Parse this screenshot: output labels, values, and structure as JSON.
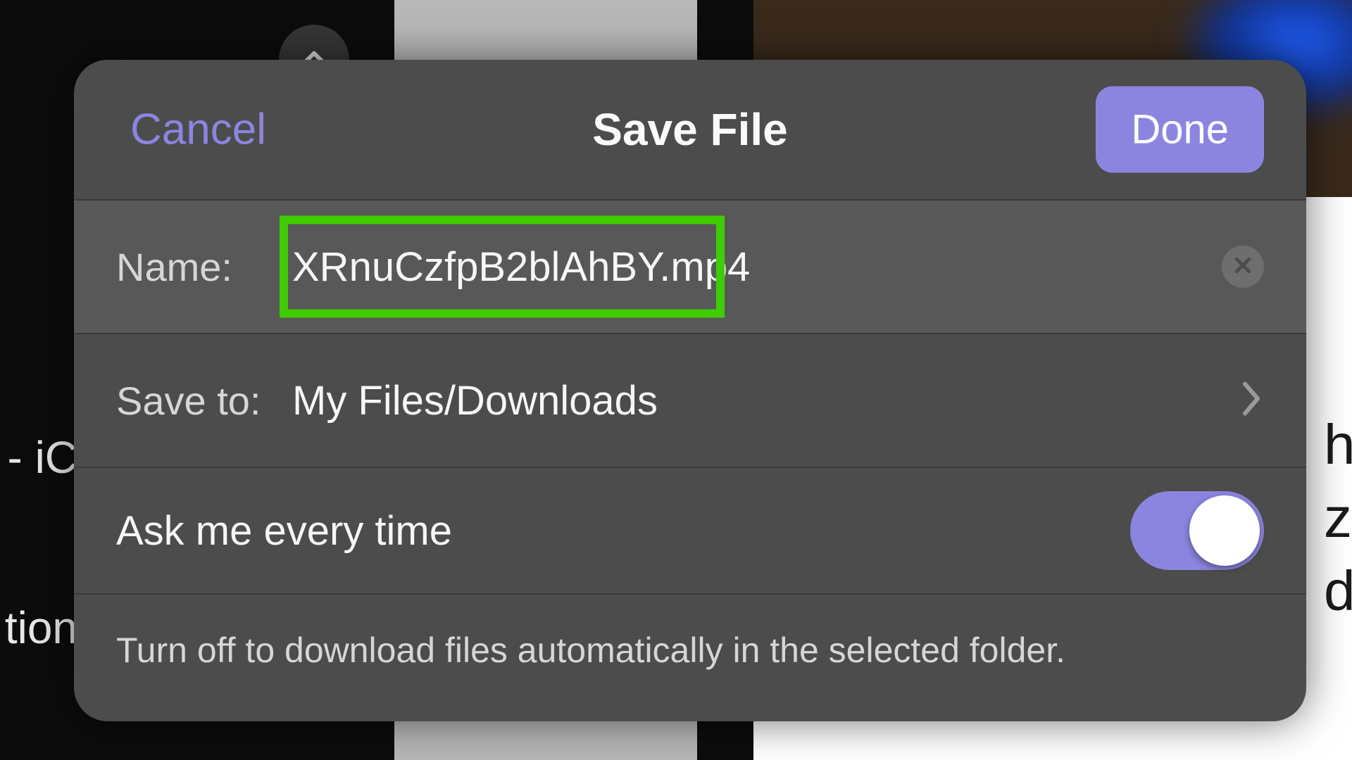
{
  "header": {
    "cancel_label": "Cancel",
    "title": "Save File",
    "done_label": "Done"
  },
  "fields": {
    "name_label": "Name:",
    "name_value": "XRnuCzfpB2blAhBY.mp4",
    "save_to_label": "Save to:",
    "save_to_value": "My Files/Downloads",
    "ask_label": "Ask me every time",
    "ask_toggle_on": true
  },
  "footer_note": "Turn off to download files automatically in the selected folder.",
  "background": {
    "left_text_1": "- iC",
    "left_text_2": "tion",
    "right_text_1": "hi",
    "right_text_2": "zr",
    "right_text_3": "dl"
  },
  "colors": {
    "accent": "#8c85e0",
    "highlight": "#3fcc00"
  }
}
